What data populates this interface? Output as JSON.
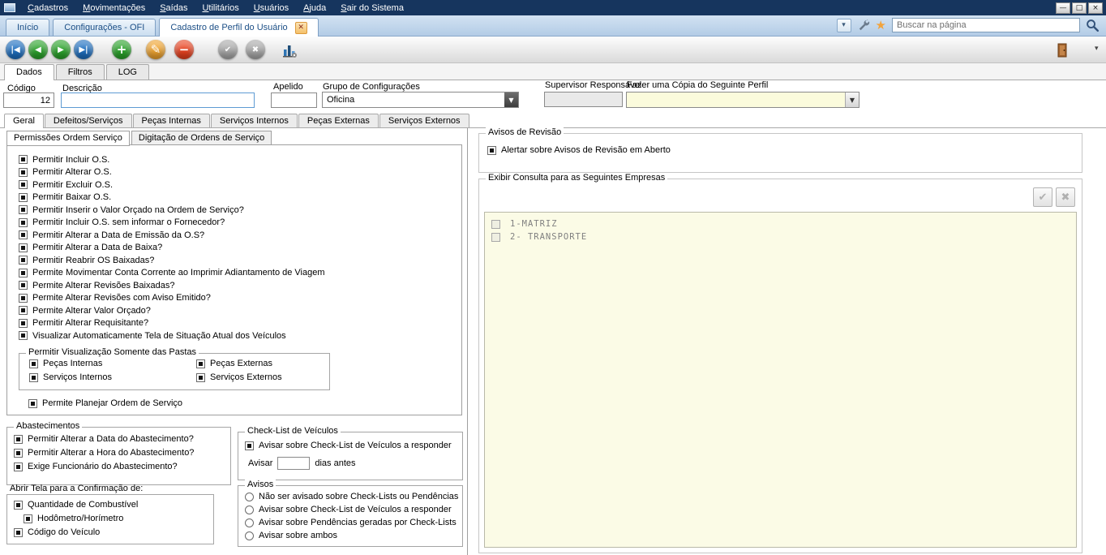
{
  "colors": {
    "menubar_bg": "#16355e",
    "tabbar_bg": "#bdd2e8",
    "tab_text": "#1c4f86",
    "field_yellow": "#fbfbdc",
    "list_yellow": "#fbfbe6",
    "field_disabled": "#e9e9e9",
    "toolbar_blue": "#1e6fc0",
    "toolbar_green": "#2ba32b",
    "toolbar_orange": "#efa32f",
    "toolbar_red": "#e8411f",
    "toolbar_disabled": "#a9a9a9"
  },
  "icons": {
    "tab_close": "✕",
    "tab_list_arrow": "▾",
    "star": "★",
    "dropdown_arrow": "▼",
    "overflow_arrow": "▾",
    "check_all": "✔",
    "uncheck_all": "✖",
    "wrench": "svg-wrench",
    "magnifier": "svg-magnifier",
    "chart": "svg-bar-chart",
    "exit_door": "svg-exit-door"
  },
  "window_controls": {
    "minimize": "—",
    "maximize": "□",
    "close": "×"
  },
  "menubar": {
    "items": [
      "Cadastros",
      "Movimentações",
      "Saídas",
      "Utilitários",
      "Usuários",
      "Ajuda",
      "Sair do Sistema"
    ]
  },
  "tabbar": {
    "tabs": [
      "Início",
      "Configurações - OFI",
      "Cadastro de Perfil do Usuário"
    ],
    "active_tab": "Cadastro de Perfil do Usuário",
    "search_placeholder": "Buscar na página"
  },
  "toolbar": {
    "buttons": [
      {
        "name": "first",
        "glyph": "|◀"
      },
      {
        "name": "previous",
        "glyph": "◀"
      },
      {
        "name": "next",
        "glyph": "▶"
      },
      {
        "name": "last",
        "glyph": "▶|"
      },
      {
        "name": "add",
        "glyph": "+"
      },
      {
        "name": "edit",
        "glyph": "✎"
      },
      {
        "name": "delete",
        "glyph": "−"
      },
      {
        "name": "confirm",
        "glyph": "✔"
      },
      {
        "name": "cancel",
        "glyph": "✖"
      }
    ]
  },
  "subtabs": [
    "Dados",
    "Filtros",
    "LOG"
  ],
  "form": {
    "codigo": {
      "label": "Código",
      "value": "12"
    },
    "descricao": {
      "label": "Descrição",
      "value": ""
    },
    "apelido": {
      "label": "Apelido",
      "value": ""
    },
    "grupo": {
      "label": "Grupo de Configurações",
      "value": "Oficina"
    },
    "supervisor": {
      "label": "Supervisor Responsável",
      "value": ""
    },
    "copia": {
      "label": "Fazer uma Cópia do Seguinte Perfil",
      "value": ""
    }
  },
  "maintabs": [
    "Geral",
    "Defeitos/Serviços",
    "Peças Internas",
    "Serviços Internos",
    "Peças Externas",
    "Serviços Externos"
  ],
  "geral": {
    "perm_tabs": [
      "Permissões Ordem Serviço",
      "Digitação de Ordens de Serviço"
    ],
    "os_items": [
      {
        "label": "Permitir Incluir O.S.",
        "checked": true
      },
      {
        "label": "Permitir Alterar O.S.",
        "checked": true
      },
      {
        "label": "Permitir Excluir O.S.",
        "checked": true
      },
      {
        "label": "Permitir Baixar O.S.",
        "checked": true
      },
      {
        "label": "Permitir Inserir o Valor Orçado na Ordem de Serviço?",
        "checked": true
      },
      {
        "label": "Permitir Incluir O.S. sem informar o Fornecedor?",
        "checked": true
      },
      {
        "label": "Permitir Alterar a Data de Emissão da O.S?",
        "checked": true
      },
      {
        "label": "Permitir Alterar a Data de Baixa?",
        "checked": true
      },
      {
        "label": "Permitir Reabrir OS Baixadas?",
        "checked": true
      },
      {
        "label": "Permite Movimentar Conta Corrente ao Imprimir Adiantamento de Viagem",
        "checked": true
      },
      {
        "label": "Permite Alterar Revisões Baixadas?",
        "checked": true
      },
      {
        "label": "Permite Alterar Revisões com Aviso Emitido?",
        "checked": true
      },
      {
        "label": "Permite Alterar Valor Orçado?",
        "checked": true
      },
      {
        "label": "Permitir Alterar Requisitante?",
        "checked": true
      },
      {
        "label": "Visualizar Automaticamente Tela de Situação Atual dos Veículos",
        "checked": true
      }
    ],
    "pastas": {
      "legend": "Permitir Visualização Somente das Pastas",
      "items": [
        {
          "label": "Peças Internas",
          "checked": true
        },
        {
          "label": "Peças Externas",
          "checked": true
        },
        {
          "label": "Serviços Internos",
          "checked": true
        },
        {
          "label": "Serviços Externos",
          "checked": true
        }
      ]
    },
    "planejar": {
      "label": "Permite Planejar Ordem de Serviço",
      "checked": true
    },
    "abastecimentos": {
      "legend": "Abastecimentos",
      "items": [
        {
          "label": "Permitir Alterar a Data do Abastecimento?",
          "checked": true
        },
        {
          "label": "Permitir Alterar a Hora do Abastecimento?",
          "checked": true
        },
        {
          "label": "Exige Funcionário do Abastecimento?",
          "checked": true
        }
      ]
    },
    "abrir_tela": {
      "label": "Abrir Tela para a Confirmação de:",
      "items": [
        {
          "label": "Quantidade de Combustível",
          "checked": true
        },
        {
          "label": "Hodômetro/Horímetro",
          "checked": true
        },
        {
          "label": "Código do Veículo",
          "checked": true
        }
      ]
    },
    "checklist": {
      "legend": "Check-List de Veículos",
      "item": {
        "label": "Avisar sobre Check-List de Veículos a responder",
        "checked": true
      },
      "avisar_label": "Avisar",
      "days_value": "",
      "suffix": "dias antes"
    },
    "avisos": {
      "legend": "Avisos",
      "options": [
        {
          "label": "Não ser avisado sobre Check-Lists ou Pendências",
          "checked": false
        },
        {
          "label": "Avisar sobre Check-List de Veículos a responder",
          "checked": false
        },
        {
          "label": "Avisar sobre Pendências geradas por Check-Lists",
          "checked": false
        },
        {
          "label": "Avisar sobre ambos",
          "checked": false
        }
      ]
    },
    "revisao": {
      "legend": "Avisos de Revisão",
      "item": {
        "label": "Alertar sobre Avisos de Revisão em Aberto",
        "checked": true
      }
    },
    "empresas": {
      "legend": "Exibir Consulta para as Seguintes Empresas",
      "rows": [
        {
          "label": "1-MATRIZ",
          "checked": false
        },
        {
          "label": "2- TRANSPORTE",
          "checked": false
        }
      ]
    }
  }
}
